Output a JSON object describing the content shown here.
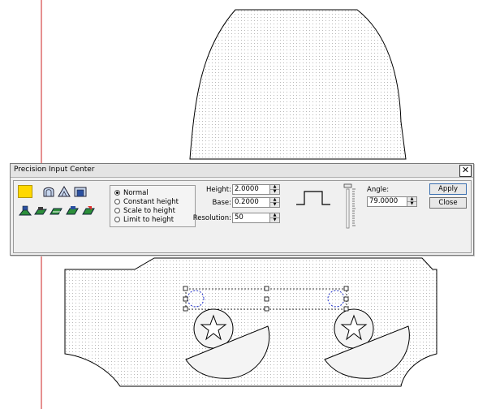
{
  "dialog": {
    "title": "Precision Input Center",
    "close_glyph": "✕",
    "toolbar": [
      {
        "icon": "yellow-square-icon",
        "selected": true
      },
      {
        "icon": "arch-profile-icon"
      },
      {
        "icon": "peak-profile-icon"
      },
      {
        "icon": "flat-profile-icon"
      },
      {
        "icon": "shape-tool-1-icon"
      },
      {
        "icon": "shape-tool-2-icon"
      },
      {
        "icon": "shape-tool-3-icon"
      },
      {
        "icon": "shape-tool-4-icon"
      },
      {
        "icon": "shape-tool-5-icon"
      }
    ],
    "modes": [
      {
        "label": "Normal",
        "selected": true
      },
      {
        "label": "Constant height",
        "selected": false
      },
      {
        "label": "Scale to height",
        "selected": false
      },
      {
        "label": "Limit to height",
        "selected": false
      }
    ],
    "fields": {
      "height": {
        "label": "Height:",
        "value": "2.0000"
      },
      "base": {
        "label": "Base:",
        "value": "0.2000"
      },
      "resolution": {
        "label": "Resolution:",
        "value": "50"
      },
      "angle": {
        "label": "Angle:",
        "value": "79.0000"
      }
    },
    "buttons": {
      "apply": "Apply",
      "close": "Close"
    }
  },
  "colors": {
    "accent_yellow": "#ffd800",
    "handle_blue": "#2233cc",
    "margin_red": "#cc2020"
  }
}
